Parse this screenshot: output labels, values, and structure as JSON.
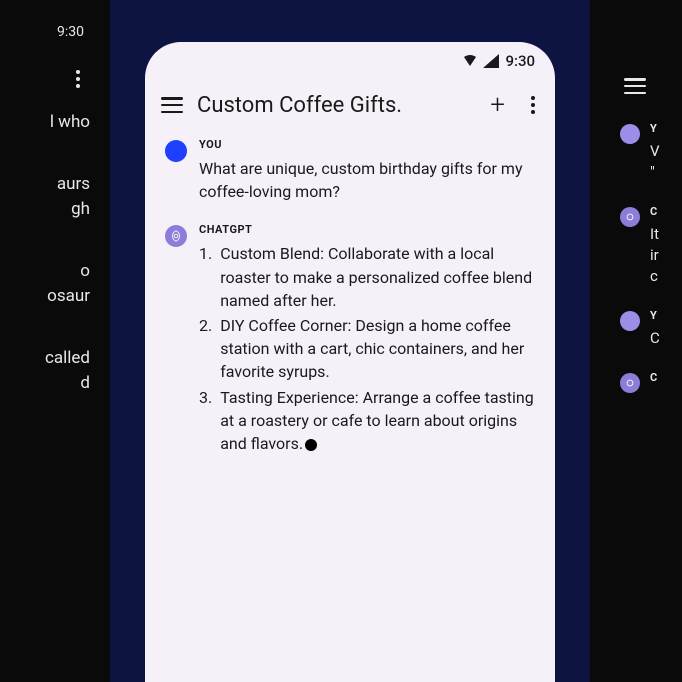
{
  "status_time": "9:30",
  "left_phone": {
    "fragments": [
      "l who",
      "aurs\ngh",
      "o\nosaur",
      "called\nd"
    ]
  },
  "center_phone": {
    "title": "Custom Coffee Gifts.",
    "user_label": "YOU",
    "user_text": "What are unique, custom birthday gifts for my coffee-loving mom?",
    "bot_label": "CHATGPT",
    "list": [
      "Custom Blend: Collaborate with a local roaster to make a personalized coffee blend named after her.",
      "DIY Coffee Corner: Design a home coffee station with a cart, chic containers, and her favorite syrups.",
      "Tasting Experience: Arrange a coffee tasting at a roastery or cafe to learn about origins and flavors."
    ]
  },
  "right_phone": {
    "msgs": [
      {
        "label": "Y",
        "text": "V\n\"",
        "avatar": "user"
      },
      {
        "label": "C",
        "text": "It\nir\nc",
        "avatar": "bot"
      },
      {
        "label": "Y",
        "text": "C",
        "avatar": "user"
      },
      {
        "label": "C",
        "text": "",
        "avatar": "bot"
      }
    ]
  }
}
